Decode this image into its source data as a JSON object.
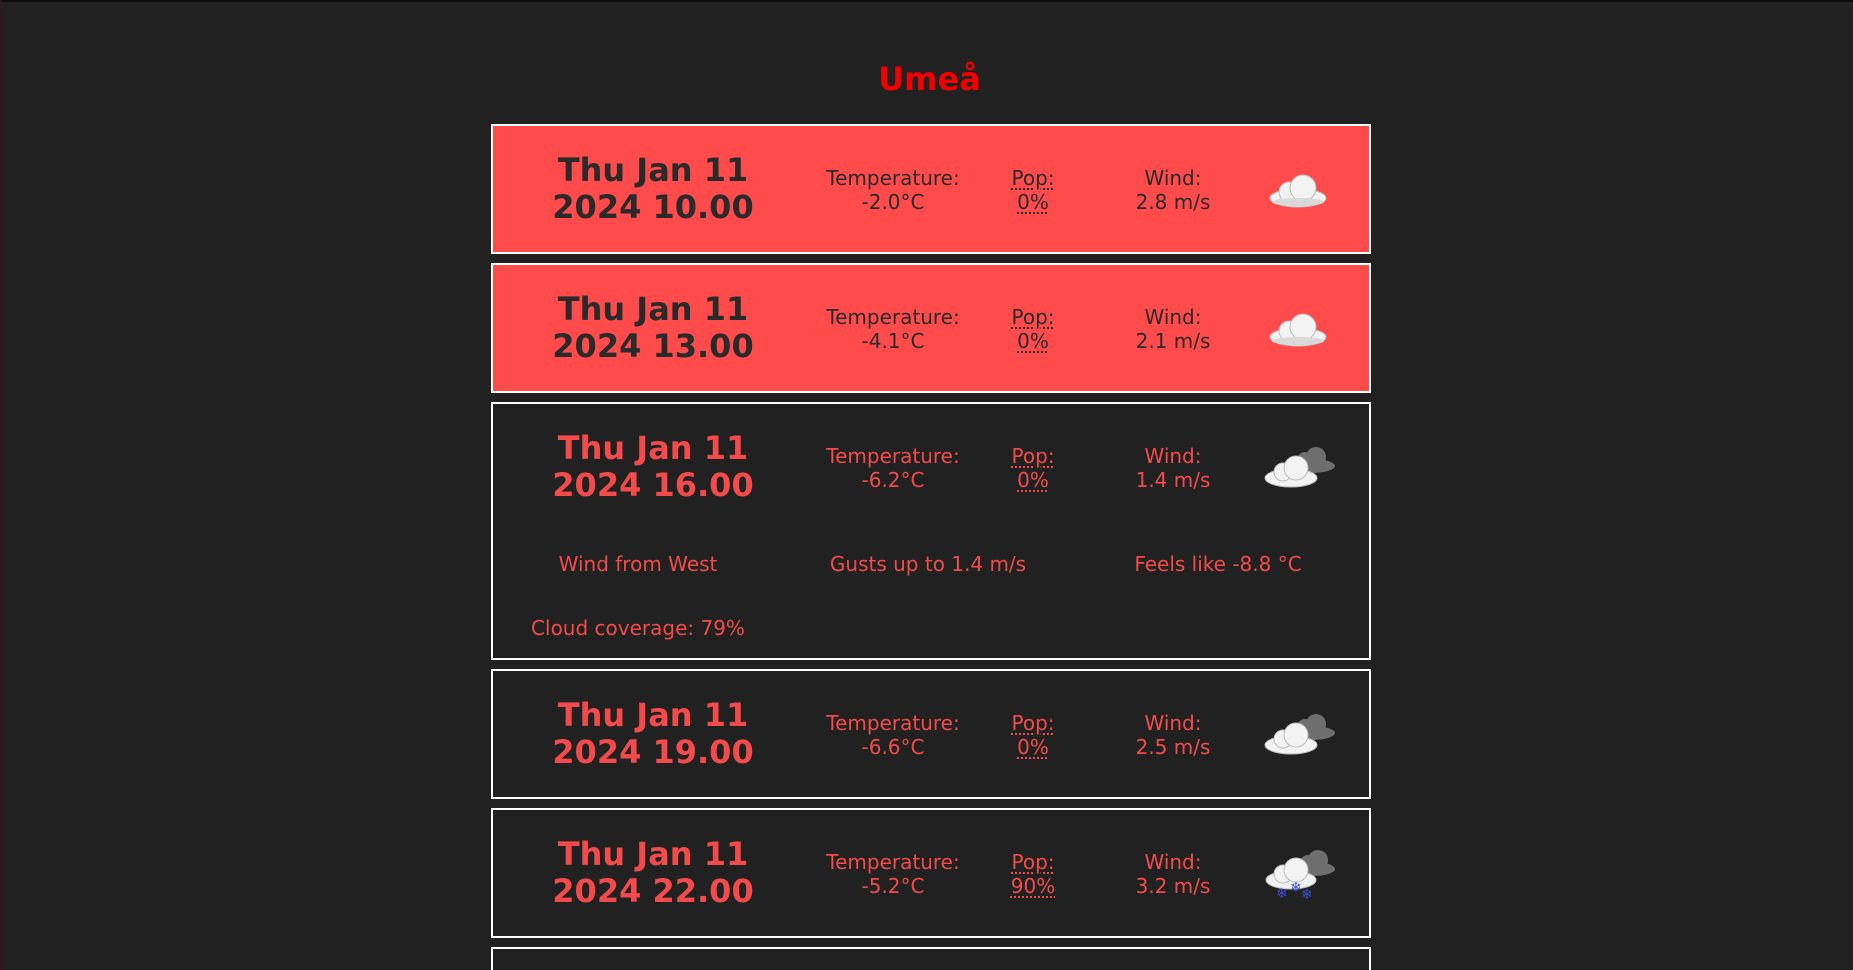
{
  "city": "Umeå",
  "forecasts": [
    {
      "date_line1": "Thu Jan 11",
      "date_line2": "2024 10.00",
      "temp_label": "Temperature:",
      "temp_value": "-2.0°C",
      "pop_label": "Pop:",
      "pop_value": "0%",
      "wind_label": "Wind:",
      "wind_value": "2.8 m/s",
      "icon": "cloud-icon",
      "highlighted": true
    },
    {
      "date_line1": "Thu Jan 11",
      "date_line2": "2024 13.00",
      "temp_label": "Temperature:",
      "temp_value": "-4.1°C",
      "pop_label": "Pop:",
      "pop_value": "0%",
      "wind_label": "Wind:",
      "wind_value": "2.1 m/s",
      "icon": "cloud-icon",
      "highlighted": true
    },
    {
      "date_line1": "Thu Jan 11",
      "date_line2": "2024 16.00",
      "temp_label": "Temperature:",
      "temp_value": "-6.2°C",
      "pop_label": "Pop:",
      "pop_value": "0%",
      "wind_label": "Wind:",
      "wind_value": "1.4 m/s",
      "icon": "broken-clouds-icon",
      "highlighted": false,
      "details": {
        "wind_direction": "Wind from West",
        "gusts": "Gusts up to 1.4 m/s",
        "feels_like": "Feels like -8.8 °C",
        "cloud_coverage": "Cloud coverage: 79%"
      }
    },
    {
      "date_line1": "Thu Jan 11",
      "date_line2": "2024 19.00",
      "temp_label": "Temperature:",
      "temp_value": "-6.6°C",
      "pop_label": "Pop:",
      "pop_value": "0%",
      "wind_label": "Wind:",
      "wind_value": "2.5 m/s",
      "icon": "broken-clouds-icon",
      "highlighted": false
    },
    {
      "date_line1": "Thu Jan 11",
      "date_line2": "2024 22.00",
      "temp_label": "Temperature:",
      "temp_value": "-5.2°C",
      "pop_label": "Pop:",
      "pop_value": "90%",
      "wind_label": "Wind:",
      "wind_value": "3.2 m/s",
      "icon": "snow-icon",
      "highlighted": false
    }
  ],
  "colors": {
    "background": "#212121",
    "accent": "#ff4b4b",
    "title": "#f00000"
  }
}
